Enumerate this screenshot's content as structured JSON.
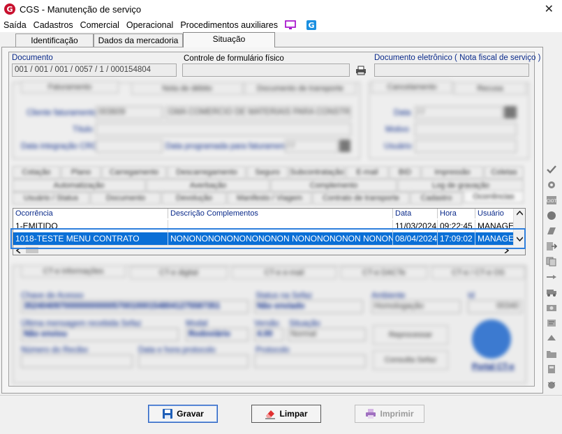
{
  "window": {
    "title": "CGS - Manutenção de serviço",
    "app_icon_letter": "G"
  },
  "menu": [
    "Saída",
    "Cadastros",
    "Comercial",
    "Operacional",
    "Procedimentos auxiliares"
  ],
  "tabs": [
    "Identificação",
    "Dados da mercadoria",
    "Situação"
  ],
  "documento": {
    "label": "Documento",
    "value": "001 / 001 / 001 / 0057 / 1 / 000154804",
    "controle_label": "Controle de formulário físico",
    "controle_value": "",
    "eletronico_label": "Documento eletrônico ( Nota fiscal de serviço )",
    "eletronico_value": ""
  },
  "faturamento": {
    "tabs": [
      "Faturamento",
      "Nota de débito",
      "Documento de transporte"
    ],
    "cliente_label": "Cliente faturamento",
    "cliente_code": "003609",
    "cliente_name": "GMA COMERCIO DE MATERIAIS PARA CONSTRUCA",
    "titulo_label": "Título",
    "data_integracao_label": "Data integração CRC",
    "data_programada_label": "Data programada para faturamento",
    "data_programada_value": "/ /"
  },
  "cancelamento": {
    "tabs": [
      "Cancelamento",
      "Recusa"
    ],
    "data_label": "Data",
    "data_value": "/ /",
    "motivo_label": "Motivo",
    "usuario_label": "Usuário"
  },
  "subtabs_row1": [
    "Cotação",
    "Plano",
    "Carregamento",
    "Descarregamento",
    "Seguro",
    "Subcontratação",
    "E-mail",
    "BID",
    "Impressão",
    "Coletas"
  ],
  "subtabs_row2": [
    "Automatização",
    "Averbação",
    "Complemento",
    "Log de gravação"
  ],
  "subtabs_row3": [
    "Usuário / Status",
    "Documento",
    "Devolução",
    "Manifesto / Viagem",
    "Contrato de transporte",
    "Cadastro",
    "Ocorrências"
  ],
  "grid": {
    "headers": [
      "Ocorrência",
      "Descrição Complementos",
      "Data",
      "Hora",
      "Usuário"
    ],
    "rows": [
      [
        "1-EMITIDO",
        "",
        "11/03/2024",
        "09:22:45",
        "MANAGER"
      ],
      [
        "1018-TESTE MENU CONTRATO",
        "NONONONONONONONONON NONONONONON NONONO",
        "08/04/2024",
        "17:09:02",
        "MANAGER"
      ]
    ]
  },
  "cte": {
    "tabs": [
      "CT-e informações",
      "CT-e digital",
      "CT-e e-mail",
      "CT-e DACTe",
      "CT-e / CT-e OS"
    ],
    "chave_label": "Chave de Acesso",
    "chave_value": "35240409700000000000570010001548041275587351",
    "status_label": "Status na Sefaz",
    "status_value": "Não enviado",
    "ambiente_label": "Ambiente",
    "ambiente_value": "Homologação",
    "id_label": "Id",
    "id_value": "00340",
    "ultima_label": "Última mensagem recebida Sefaz",
    "ultima_value": "Não enviou",
    "modal_label": "Modal",
    "modal_value": "Rodoviário",
    "versao_label": "Versão",
    "versao_value": "4.00",
    "situacao_label": "Situação",
    "situacao_value": "Normal",
    "numero_label": "Número do Recibo",
    "data_protocolo_label": "Data e hora protocolo",
    "protocolo_label": "Protocolo",
    "reprocessar_label": "Reprocessar",
    "consulta_label": "Consulta Sefaz",
    "portal_label": "Portal CT-e"
  },
  "buttons": {
    "gravar": "Gravar",
    "limpar": "Limpar",
    "imprimir": "Imprimir"
  },
  "colors": {
    "selection": "#0a6fd6",
    "label_blue": "#0a2a8a",
    "highlight_border": "#2f7fdc"
  }
}
